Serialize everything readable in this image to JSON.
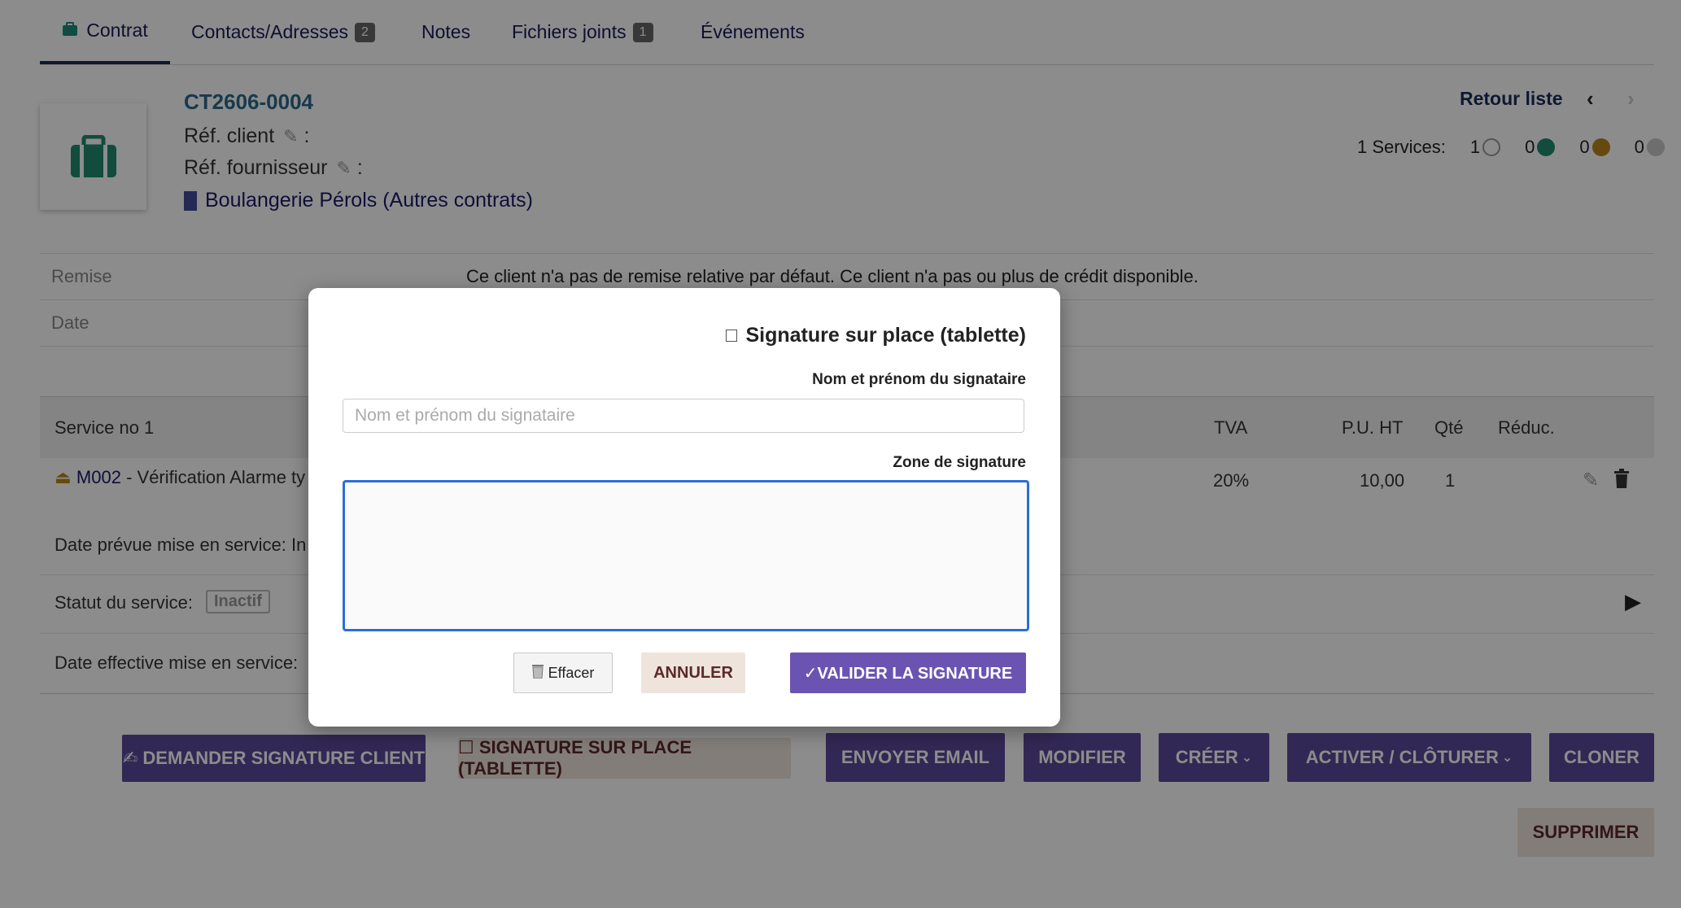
{
  "tabs": [
    {
      "label": "Contrat",
      "badge": ""
    },
    {
      "label": "Contacts/Adresses",
      "badge": "2"
    },
    {
      "label": "Notes",
      "badge": ""
    },
    {
      "label": "Fichiers joints",
      "badge": "1"
    },
    {
      "label": "Événements",
      "badge": ""
    }
  ],
  "header": {
    "ref": "CT2606-0004",
    "ref_client_label": "Réf. client",
    "ref_fournisseur_label": "Réf. fournisseur",
    "colon": ":",
    "thirdparty": "Boulangerie Pérols (Autres contrats)",
    "retour": "Retour liste",
    "services_label": "1 Services:",
    "counts": [
      "1",
      "0",
      "0",
      "0"
    ],
    "status_colors": [
      "#ffffff",
      "#1f8a6e",
      "#b8861b",
      "#c8c8c8"
    ]
  },
  "info": {
    "remise_label": "Remise",
    "remise_value": "Ce client n'a pas de remise relative par défaut. Ce client n'a pas ou plus de crédit disponible.",
    "date_label": "Date"
  },
  "table": {
    "head": {
      "service": "Service no 1",
      "tva": "TVA",
      "pu_ht": "P.U. HT",
      "qte": "Qté",
      "reduc": "Réduc."
    },
    "row": {
      "code": "M002",
      "desc": " - Vérification Alarme ty",
      "tva": "20%",
      "pu": "10,00",
      "qte": "1"
    },
    "date_prevue": "Date prévue mise en service: In",
    "statut_label": "Statut du service:",
    "statut_value": "Inactif",
    "date_effective": "Date effective mise en service:"
  },
  "actions": {
    "demander": "✍ DEMANDER SIGNATURE CLIENT",
    "sur_place": "☐ SIGNATURE SUR PLACE (TABLETTE)",
    "envoyer": "ENVOYER EMAIL",
    "modifier": "MODIFIER",
    "creer": "CRÉER",
    "activer": "ACTIVER / CLÔTURER",
    "cloner": "CLONER",
    "supprimer": "SUPPRIMER"
  },
  "modal": {
    "title": "Signature sur place (tablette)",
    "name_label": "Nom et prénom du signataire",
    "name_placeholder": "Nom et prénom du signataire",
    "zone_label": "Zone de signature",
    "effacer": "Effacer",
    "annuler": "ANNULER",
    "valider": "✓VALIDER LA SIGNATURE"
  }
}
